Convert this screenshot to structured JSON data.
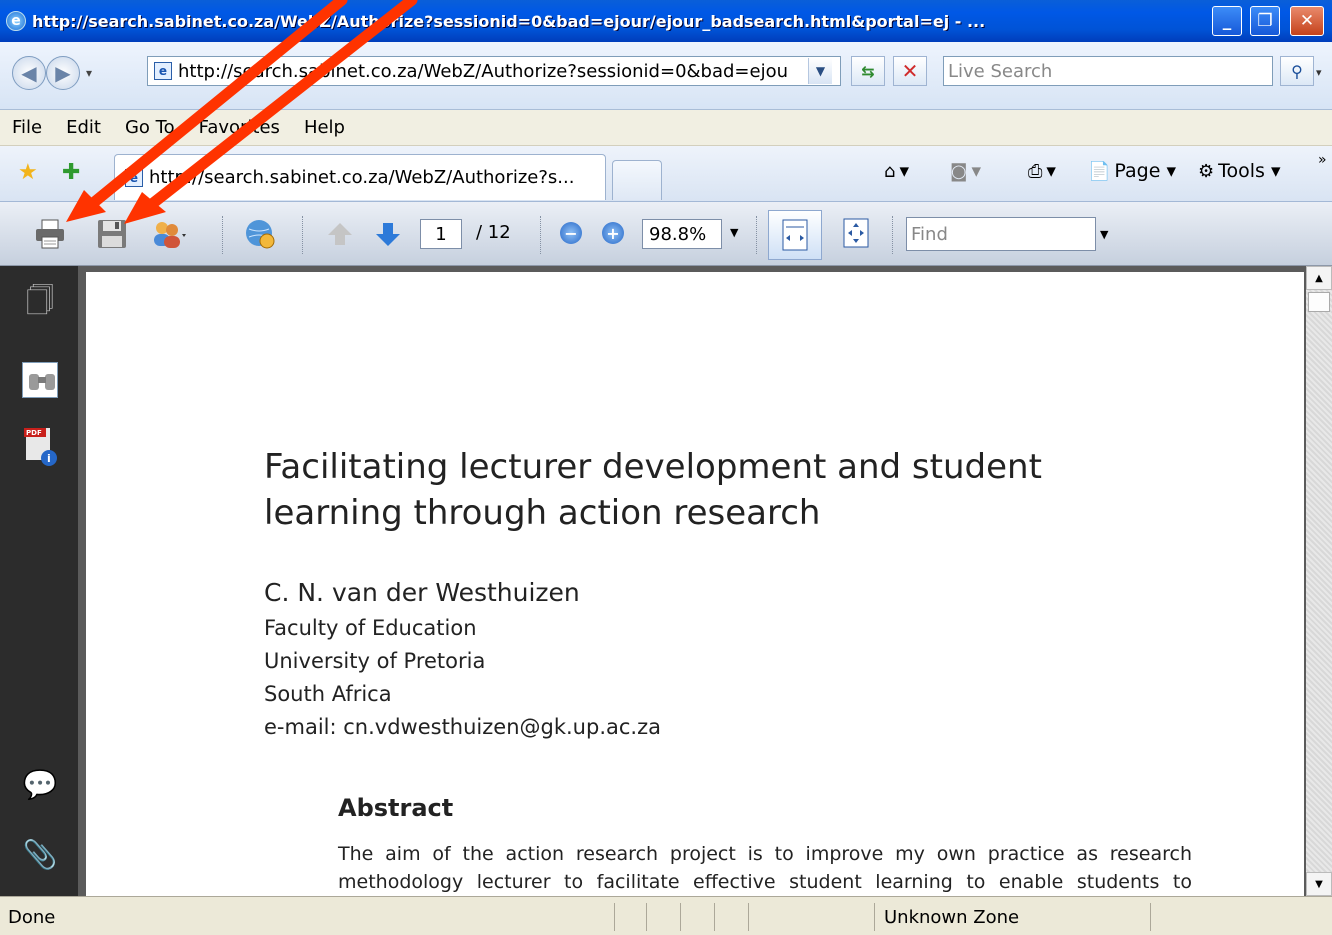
{
  "window": {
    "title": "http://search.sabinet.co.za/WebZ/Authorize?sessionid=0&bad=ejour/ejour_badsearch.html&portal=ej - ..."
  },
  "address_bar": {
    "url": "http://search.sabinet.co.za/WebZ/Authorize?sessionid=0&bad=ejou",
    "search_placeholder": "Live Search"
  },
  "menu": {
    "items": [
      "File",
      "Edit",
      "Go To",
      "Favorites",
      "Help"
    ]
  },
  "tabs": {
    "active_label": "http://search.sabinet.co.za/WebZ/Authorize?s..."
  },
  "command_bar": {
    "page_label": "Page",
    "tools_label": "Tools"
  },
  "pdf_toolbar": {
    "current_page": "1",
    "page_total": "/ 12",
    "zoom": "98.8%",
    "find_placeholder": "Find"
  },
  "document": {
    "title": "Facilitating lecturer development and student learning through action research",
    "author": "C. N. van der Westhuizen",
    "affiliation": [
      "Faculty of Education",
      "University of Pretoria",
      "South Africa",
      "e-mail: cn.vdwesthuizen@gk.up.ac.za"
    ],
    "abstract_heading": "Abstract",
    "abstract_text": "The aim of the action research project is to improve my own practice as research methodology lecturer to facilitate effective student learning to enable students to become"
  },
  "status_bar": {
    "status": "Done",
    "zone": "Unknown Zone"
  },
  "colors": {
    "titlebar": "#0058e6",
    "annotation_arrow": "#ff3300"
  },
  "icons": {
    "print": "printer-icon",
    "save": "floppy-disk-icon",
    "annotation": "red-arrow"
  }
}
